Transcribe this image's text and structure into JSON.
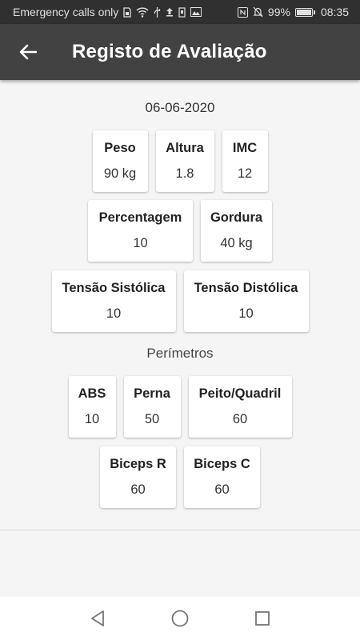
{
  "status_bar": {
    "carrier_text": "Emergency calls only",
    "battery_percent": "99%",
    "battery_level": 0.99,
    "time": "08:35"
  },
  "app_bar": {
    "title": "Registo de Avaliação",
    "back_icon": "arrow-left-icon"
  },
  "evaluation": {
    "date": "06-06-2020",
    "row1": [
      {
        "label": "Peso",
        "value": "90 kg"
      },
      {
        "label": "Altura",
        "value": "1.8"
      },
      {
        "label": "IMC",
        "value": "12"
      }
    ],
    "row2": [
      {
        "label": "Percentagem",
        "value": "10"
      },
      {
        "label": "Gordura",
        "value": "40 kg"
      }
    ],
    "row3": [
      {
        "label": "Tensão Sistólica",
        "value": "10"
      },
      {
        "label": "Tensão Distólica",
        "value": "10"
      }
    ]
  },
  "perimeters": {
    "title": "Perímetros",
    "row1": [
      {
        "label": "ABS",
        "value": "10"
      },
      {
        "label": "Perna",
        "value": "50"
      },
      {
        "label": "Peito/Quadril",
        "value": "60"
      }
    ],
    "row2": [
      {
        "label": "Biceps R",
        "value": "60"
      },
      {
        "label": "Biceps C",
        "value": "60"
      }
    ]
  },
  "nav_bar": {
    "back_icon": "triangle-back-icon",
    "home_icon": "circle-home-icon",
    "recents_icon": "square-recents-icon"
  },
  "colors": {
    "status_bar_bg": "#303030",
    "app_bar_bg": "#424242",
    "background": "#f5f5f5",
    "card_bg": "#ffffff"
  }
}
